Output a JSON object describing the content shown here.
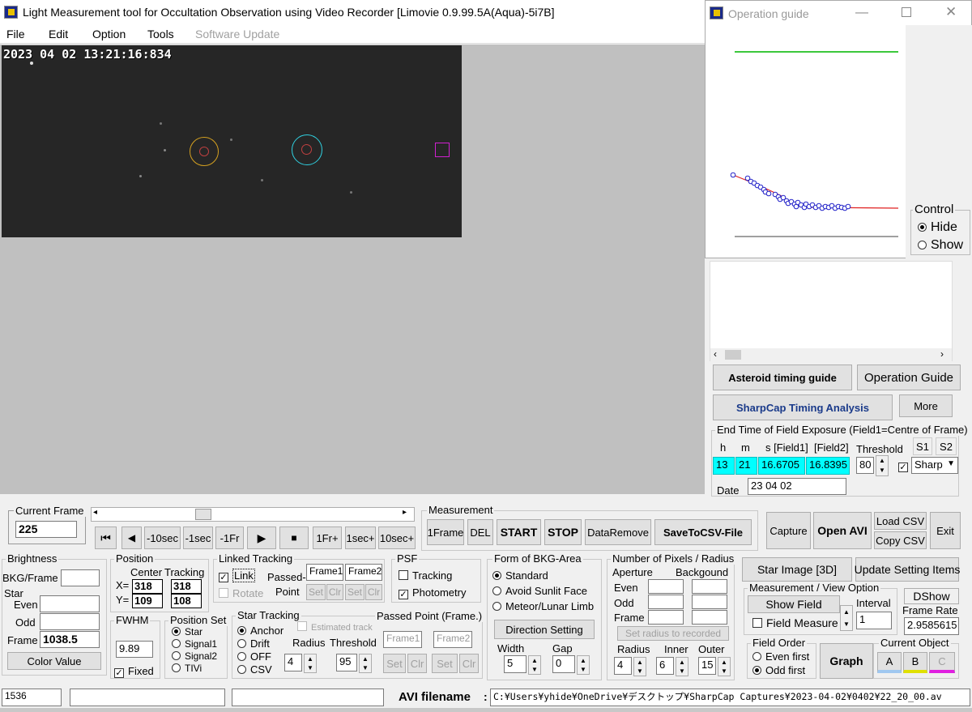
{
  "window": {
    "title": "Light Measurement tool for Occultation Observation using Video Recorder [Limovie 0.9.99.5A(Aqua)-5i7B]"
  },
  "menu": [
    "File",
    "Edit",
    "Option",
    "Tools",
    "Software Update"
  ],
  "video": {
    "timestamp": "2023 04 02 13:21:16:834"
  },
  "guide": {
    "title": "Operation guide",
    "control_label": "Control",
    "hide_label": "Hide",
    "show_label": "Show",
    "colors": {
      "top_line": "#3cc83c",
      "fit_line": "#e02020",
      "points": "#2020c8",
      "base_line": "#808080"
    }
  },
  "right_buttons": {
    "asteroid": "Asteroid timing guide",
    "operation": "Operation Guide",
    "sharpcap": "SharpCap Timing Analysis",
    "more": "More"
  },
  "field_exposure": {
    "label": "End Time of Field Exposure (Field1=Centre of Frame)",
    "h_label": "h",
    "m_label": "m",
    "s_label": "s [Field1]",
    "f2_label": "[Field2]",
    "threshold_label": "Threshold",
    "s1": "S1",
    "s2": "S2",
    "h": "13",
    "m": "21",
    "s1_val": "16.6705",
    "s2_val": "16.8395",
    "threshold": "80",
    "sharp": "Sharp",
    "date_label": "Date",
    "date": "23 04 02"
  },
  "current_frame": {
    "label": "Current Frame",
    "value": "225"
  },
  "transport": [
    "⏮",
    "◀",
    "-10sec",
    "-1sec",
    "-1Fr",
    "▶",
    "■",
    "1Fr+",
    "1sec+",
    "10sec+"
  ],
  "measurement": {
    "label": "Measurement",
    "buttons": [
      "1Frame",
      "DEL",
      "START",
      "STOP",
      "DataRemove",
      "SaveToCSV-File"
    ]
  },
  "file_buttons": {
    "capture": "Capture",
    "open_avi": "Open AVI",
    "load_csv": "Load CSV",
    "copy_csv": "Copy CSV",
    "exit": "Exit"
  },
  "brightness": {
    "label": "Brightness",
    "bkg_label": "BKG/Frame",
    "star_label": "Star",
    "even_label": "Even",
    "odd_label": "Odd",
    "frame_label": "Frame",
    "frame_value": "1038.5",
    "color_value": "Color Value"
  },
  "position": {
    "label": "Position",
    "center_label": "Center",
    "tracking_label": "Tracking",
    "x_label": "X=",
    "y_label": "Y=",
    "x_center": "318",
    "y_center": "109",
    "x_tracking": "318",
    "y_tracking": "108"
  },
  "linked_tracking": {
    "label": "Linked Tracking",
    "link": "Link",
    "rotate": "Rotate",
    "passed_label": "Passed-",
    "point_label": "Point",
    "frame1": "Frame1",
    "frame2": "Frame2",
    "set": "Set",
    "clr": "Clr"
  },
  "psf": {
    "label": "PSF",
    "tracking": "Tracking",
    "photometry": "Photometry"
  },
  "fwhm": {
    "label": "FWHM",
    "value": "9.89",
    "fixed": "Fixed"
  },
  "position_set": {
    "label": "Position Set",
    "options": [
      "Star",
      "Signal1",
      "Signal2",
      "TIVi"
    ]
  },
  "star_tracking": {
    "label": "Star Tracking",
    "options": [
      "Anchor",
      "Drift",
      "OFF",
      "CSV"
    ],
    "estimated": "Estimated track",
    "radius_label": "Radius",
    "threshold_label": "Threshold",
    "radius": "4",
    "threshold": "95",
    "passed_label": "Passed Point (Frame.)",
    "frame1": "Frame1",
    "frame2": "Frame2",
    "set": "Set",
    "clr": "Clr"
  },
  "bkg_area": {
    "label": "Form of BKG-Area",
    "options": [
      "Standard",
      "Avoid Sunlit Face",
      "Meteor/Lunar Limb"
    ],
    "direction": "Direction Setting",
    "width_label": "Width",
    "gap_label": "Gap",
    "width": "5",
    "gap": "0"
  },
  "pixels": {
    "label": "Number of Pixels / Radius",
    "aperture": "Aperture",
    "background": "Backgound",
    "even": "Even",
    "odd": "Odd",
    "frame": "Frame",
    "set_radius": "Set  radius to recorded",
    "radius_label": "Radius",
    "inner_label": "Inner",
    "outer_label": "Outer",
    "radius": "4",
    "inner": "6",
    "outer": "15"
  },
  "view": {
    "star_image": "Star Image [3D]",
    "update": "Update Setting Items",
    "mv_label": "Measurement / View Option",
    "show_field": "Show Field",
    "field_measure": "Field Measure",
    "interval_label": "Interval",
    "interval": "1",
    "dshow": "DShow",
    "frame_rate_label": "Frame Rate",
    "frame_rate": "2.9585615"
  },
  "field_order": {
    "label": "Field Order",
    "even": "Even first",
    "odd": "Odd first",
    "graph": "Graph"
  },
  "current_object": {
    "label": "Current Object",
    "a": "A",
    "b": "B",
    "c": "C",
    "colors": {
      "a": "#a0c8f0",
      "b": "#e0e000",
      "c": "#e020e0"
    }
  },
  "status": {
    "frame_count": "1536",
    "avi_label": "AVI filename",
    "avi_path": "C:¥Users¥yhide¥OneDrive¥デスクトップ¥SharpCap Captures¥2023-04-02¥0402¥22_20_00.av"
  }
}
